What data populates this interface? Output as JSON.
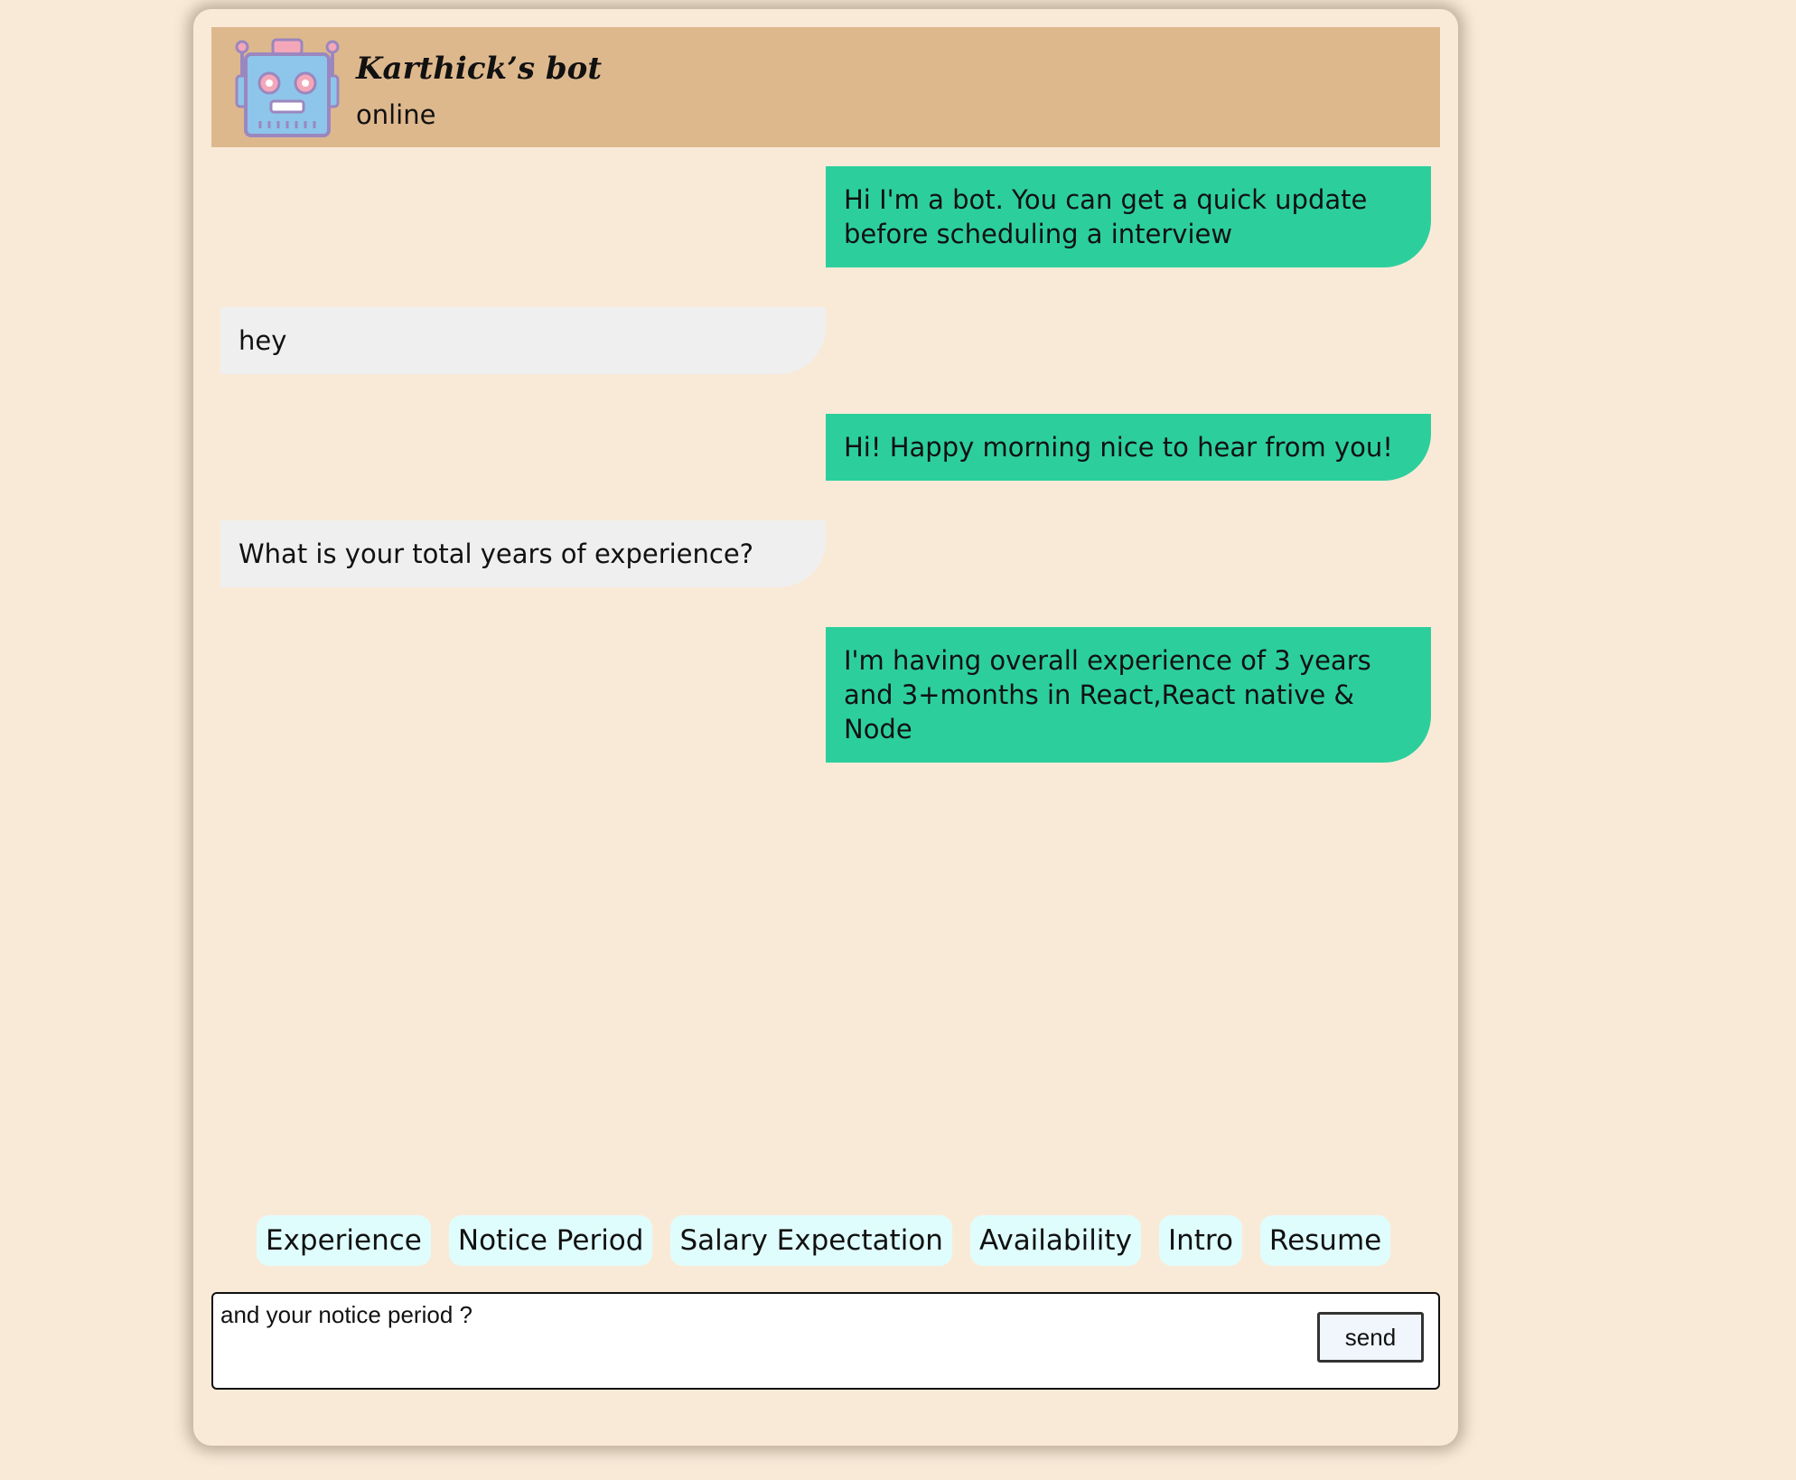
{
  "header": {
    "bot_name": "Karthick’s bot",
    "status": "online",
    "avatar_icon": "robot-icon"
  },
  "messages": [
    {
      "sender": "bot",
      "text": "Hi I'm a bot. You can get a quick update before scheduling a interview"
    },
    {
      "sender": "user",
      "text": "hey"
    },
    {
      "sender": "bot",
      "text": "Hi! Happy morning nice to hear from you!"
    },
    {
      "sender": "user",
      "text": "What is your total years of experience?"
    },
    {
      "sender": "bot",
      "text": "I'm having overall experience of 3 years and 3+months in React,React native & Node"
    }
  ],
  "suggestions": [
    "Experience",
    "Notice Period",
    "Salary Expectation",
    "Availability",
    "Intro",
    "Resume"
  ],
  "composer": {
    "value": "and your notice period ?",
    "send_label": "send"
  },
  "colors": {
    "page_background": "#f9ead8",
    "header_background": "#deb88d",
    "bot_bubble": "#2ccf9c",
    "user_bubble": "#efefef",
    "chip_background": "#e0fdfd"
  }
}
